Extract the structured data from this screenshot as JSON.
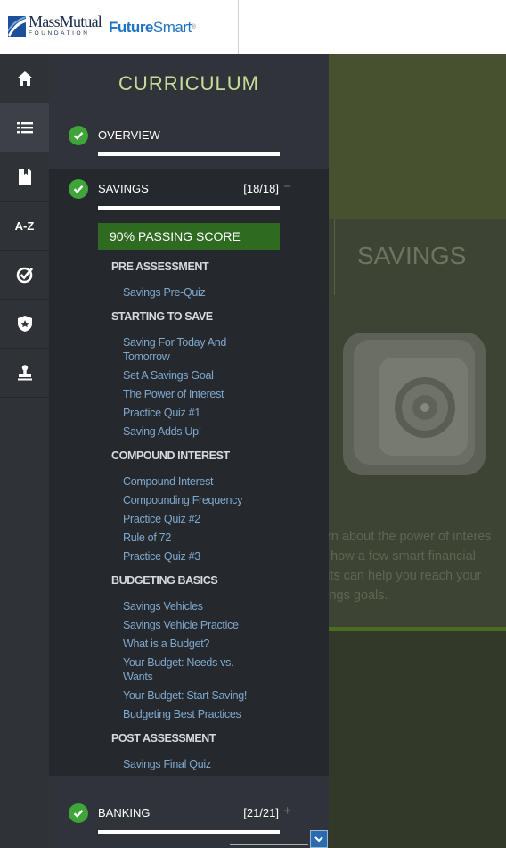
{
  "header": {
    "brand_name": "MassMutual",
    "brand_sub": "FOUNDATION",
    "product_a": "Future",
    "product_b": "Smart",
    "product_tm": "®"
  },
  "nav": {
    "az_label": "A-Z",
    "icons": [
      "home-icon",
      "list-icon",
      "book-icon",
      "a-z-icon",
      "check-badge-icon",
      "shield-star-icon",
      "stamp-icon"
    ]
  },
  "curriculum": {
    "title": "CURRICULUM",
    "sections": [
      {
        "label": "OVERVIEW"
      },
      {
        "label": "SAVINGS",
        "count": "[18/18]",
        "toggle": "−"
      },
      {
        "label": "BANKING",
        "count": "[21/21]",
        "toggle": "+"
      }
    ],
    "passing_score": "90% PASSING SCORE",
    "groups": [
      {
        "title": "PRE ASSESSMENT",
        "items": [
          "Savings Pre-Quiz"
        ]
      },
      {
        "title": "STARTING TO SAVE",
        "items": [
          "Saving For Today And Tomorrow",
          "Set A Savings Goal",
          "The Power of Interest",
          "Practice Quiz #1",
          "Saving Adds Up!"
        ]
      },
      {
        "title": "COMPOUND INTEREST",
        "items": [
          "Compound Interest",
          "Compounding Frequency",
          "Practice Quiz #2",
          "Rule of 72",
          "Practice Quiz #3"
        ]
      },
      {
        "title": "BUDGETING BASICS",
        "items": [
          "Savings Vehicles",
          "Savings Vehicle Practice",
          "What is a Budget?",
          "Your Budget: Needs vs. Wants",
          "Your Budget: Start Saving!",
          "Budgeting Best Practices"
        ]
      },
      {
        "title": "POST ASSESSMENT",
        "items": [
          "Savings Final Quiz"
        ]
      }
    ]
  },
  "background": {
    "title": "SAVINGS",
    "lines": [
      "arn about the power of interes",
      "d how a few smart financial",
      "bits can help you reach your",
      "vings goals."
    ]
  }
}
